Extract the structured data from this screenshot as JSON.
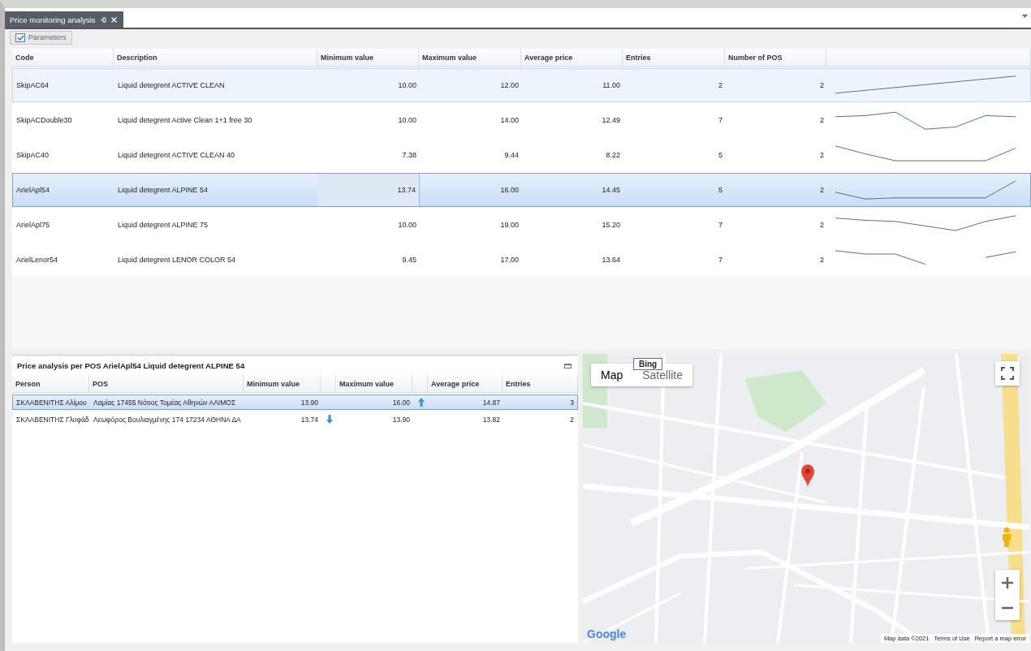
{
  "tab": {
    "title": "Price monitoring analysis",
    "selected": true
  },
  "toolbar": {
    "parameters_button": {
      "label": "Parameters",
      "checked": true
    }
  },
  "products": {
    "columns": [
      "Code",
      "Description",
      "Minimum value",
      "Maximum value",
      "Average price",
      "Entries",
      "Number of POS"
    ],
    "rows": [
      {
        "code": "SkipAC64",
        "description": "Liquid detegrent ACTIVE CLEAN",
        "min": "10.00",
        "max": "12.00",
        "avg": "11.00",
        "entries": "2",
        "pos_count": "2",
        "selected": false,
        "hovered": true
      },
      {
        "code": "SkipACDouble30",
        "description": "Liquid detegrent Active Clean 1+1 free 30",
        "min": "10.00",
        "max": "14.00",
        "avg": "12.49",
        "entries": "7",
        "pos_count": "2",
        "selected": false,
        "hovered": false
      },
      {
        "code": "SkipAC40",
        "description": "Liquid detegrent ACTIVE CLEAN 40",
        "min": "7.38",
        "max": "9.44",
        "avg": "8.22",
        "entries": "5",
        "pos_count": "2",
        "selected": false,
        "hovered": false
      },
      {
        "code": "ArielApl54",
        "description": "Liquid detegrent ALPINE 54",
        "min": "13.74",
        "max": "16.00",
        "avg": "14.45",
        "entries": "5",
        "pos_count": "2",
        "selected": true,
        "hovered": false
      },
      {
        "code": "ArielApl75",
        "description": "Liquid detegrent ALPINE 75",
        "min": "10.00",
        "max": "19.00",
        "avg": "15.20",
        "entries": "7",
        "pos_count": "2",
        "selected": false,
        "hovered": false
      },
      {
        "code": "ArielLenor54",
        "description": "Liquid detegrent LENOR COLOR 54",
        "min": "9.45",
        "max": "17.00",
        "avg": "13.64",
        "entries": "7",
        "pos_count": "2",
        "selected": false,
        "hovered": false
      }
    ]
  },
  "pos_panel": {
    "title": "Price analysis per POS ArielApl54 Liquid detegrent ALPINE 54",
    "columns": [
      "Person",
      "POS",
      "Minimum value",
      "Maximum value",
      "Average price",
      "Entries"
    ],
    "rows": [
      {
        "person": "ΣΚΛΑΒΕΝΙΤΗΣ Αλίμου",
        "pos": "Λαμίας 17455 Νότιος Τομέας Αθηνών ΑΛΙΜΟΣ",
        "min": "13.90",
        "min_down": false,
        "max": "16.00",
        "max_up": true,
        "avg": "14.87",
        "entries": "3",
        "selected": true
      },
      {
        "person": "ΣΚΛΑΒΕΝΙΤΗΣ Γλυφάδ",
        "pos": "Λεωφόρος Βουλιαγμένης 174 17234 ΑΘΗΝΑ ΔΑ",
        "min": "13.74",
        "min_down": true,
        "max": "13.90",
        "max_up": false,
        "avg": "13.82",
        "entries": "2",
        "selected": false
      }
    ]
  },
  "map": {
    "type_buttons": [
      {
        "label": "Map",
        "selected": true
      },
      {
        "label": "Satellite",
        "selected": false
      }
    ],
    "provider_badge": "Bing",
    "logo": "Google",
    "attribution": "Map data ©2021",
    "links": [
      "Terms of Use",
      "Report a map error"
    ]
  }
}
